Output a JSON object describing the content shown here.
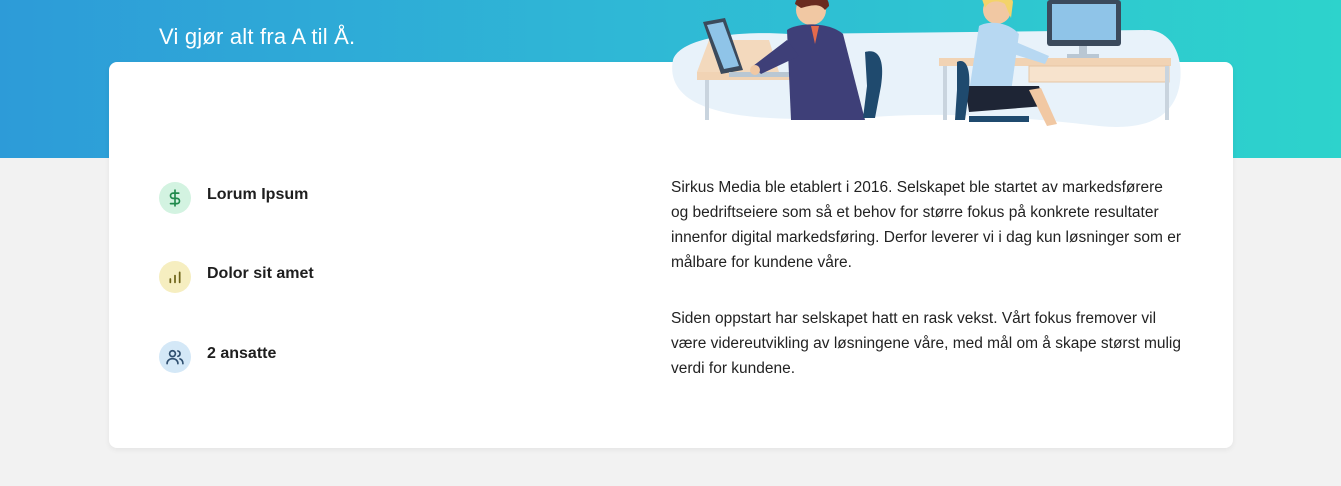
{
  "hero": {
    "title": "Vi gjør alt fra A til Å."
  },
  "features": [
    {
      "label": "Lorum Ipsum",
      "icon": "dollar-icon",
      "color": "#1f8a4c"
    },
    {
      "label": "Dolor sit amet",
      "icon": "bar-chart-icon",
      "color": "#8a7a1a"
    },
    {
      "label": "2 ansatte",
      "icon": "users-icon",
      "color": "#2f4f6f"
    }
  ],
  "about": {
    "paragraph1": "Sirkus Media ble etablert i 2016. Selskapet ble startet av markedsførere og bedriftseiere som så et behov for større fokus på konkrete resultater innenfor digital markedsføring. Derfor leverer vi i dag kun løsninger som er målbare for kundene våre.",
    "paragraph2": "Siden oppstart har selskapet hatt en rask vekst. Vårt fokus fremover vil være videreutvikling av løsningene våre, med mål om å skape størst mulig verdi for kundene."
  },
  "colors": {
    "hero_gradient_start": "#2d9bd8",
    "hero_gradient_end": "#2dd3cc",
    "page_background": "#f2f2f2",
    "card_background": "#ffffff"
  }
}
